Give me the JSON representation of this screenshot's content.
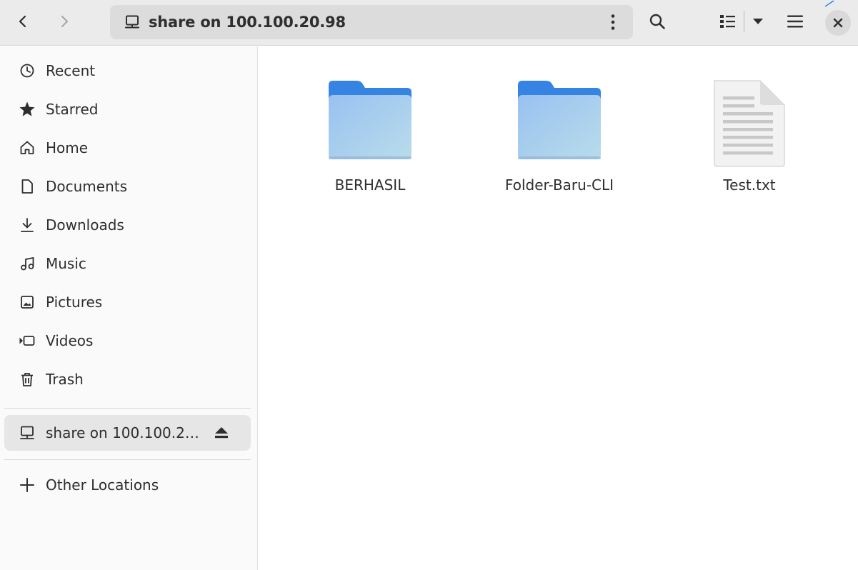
{
  "header": {
    "location_title": "share on 100.100.20.98",
    "icons": {
      "back": "chevron-left-icon",
      "forward": "chevron-right-icon",
      "network": "network-drive-icon",
      "path_menu": "kebab-menu-icon",
      "search": "search-icon",
      "view_list": "list-view-icon",
      "view_dropdown": "caret-down-icon",
      "main_menu": "hamburger-menu-icon",
      "close": "close-icon"
    }
  },
  "sidebar": {
    "places": [
      {
        "label": "Recent",
        "icon": "clock-icon"
      },
      {
        "label": "Starred",
        "icon": "star-icon"
      },
      {
        "label": "Home",
        "icon": "home-icon"
      },
      {
        "label": "Documents",
        "icon": "document-icon"
      },
      {
        "label": "Downloads",
        "icon": "download-icon"
      },
      {
        "label": "Music",
        "icon": "music-icon"
      },
      {
        "label": "Pictures",
        "icon": "picture-icon"
      },
      {
        "label": "Videos",
        "icon": "video-icon"
      },
      {
        "label": "Trash",
        "icon": "trash-icon"
      }
    ],
    "mount": {
      "label": "share on 100.100.2…",
      "icon": "network-drive-icon",
      "action_icon": "eject-icon",
      "active": true
    },
    "other_locations": {
      "label": "Other Locations",
      "icon": "plus-icon"
    }
  },
  "files": [
    {
      "name": "BERHASIL",
      "type": "folder"
    },
    {
      "name": "Folder-Baru-CLI",
      "type": "folder"
    },
    {
      "name": "Test.txt",
      "type": "text-file"
    }
  ],
  "colors": {
    "folder_tab": "#3584e4",
    "folder_body_top": "#99c1f1",
    "folder_body_bottom": "#b9dcea",
    "header_bg": "#ebebeb",
    "sidebar_bg": "#fafafa",
    "active_row": "#e6e6e6"
  }
}
